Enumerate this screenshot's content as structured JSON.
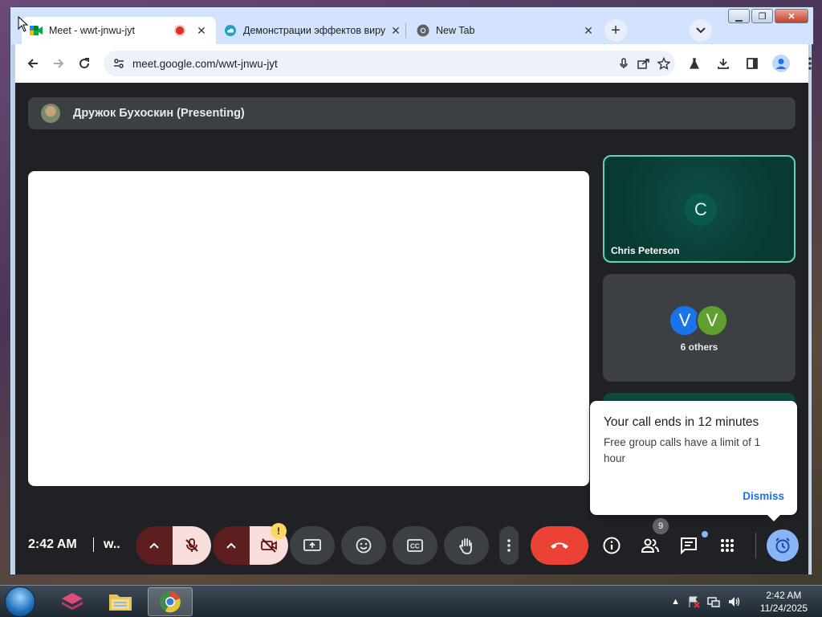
{
  "browser": {
    "tabs": [
      {
        "label": "Meet - wwt-jnwu-jyt",
        "active": true,
        "recording": true
      },
      {
        "label": "Демонстрации эффектов виру",
        "active": false
      },
      {
        "label": "New Tab",
        "active": false
      }
    ],
    "url": "meet.google.com/wwt-jnwu-jyt",
    "new_tab_label": "+"
  },
  "meet": {
    "presenter_bar": "Дружок Бухоскин (Presenting)",
    "participants": {
      "main_tile": {
        "initial": "C",
        "name": "Chris Peterson"
      },
      "others_tile": {
        "initials": [
          "V",
          "V"
        ],
        "label": "6 others",
        "colors": [
          "#1a73e8",
          "#5f9e2f"
        ]
      }
    },
    "popup": {
      "title": "Your call ends in 12 minutes",
      "message": "Free group calls have a limit of 1 hour",
      "dismiss_label": "Dismiss"
    },
    "controls": {
      "time": "2:42 AM",
      "meeting_code_short": "w..",
      "camera_warning": "!",
      "people_count": "9"
    }
  },
  "taskbar": {
    "clock_time": "2:42 AM",
    "clock_date": "11/24/2025"
  },
  "colors": {
    "end_call": "#ea4335",
    "active_tile_border": "#5fd3bc",
    "accent_blue": "#8ab4f8",
    "mic_off_bg": "#f9dedc"
  }
}
